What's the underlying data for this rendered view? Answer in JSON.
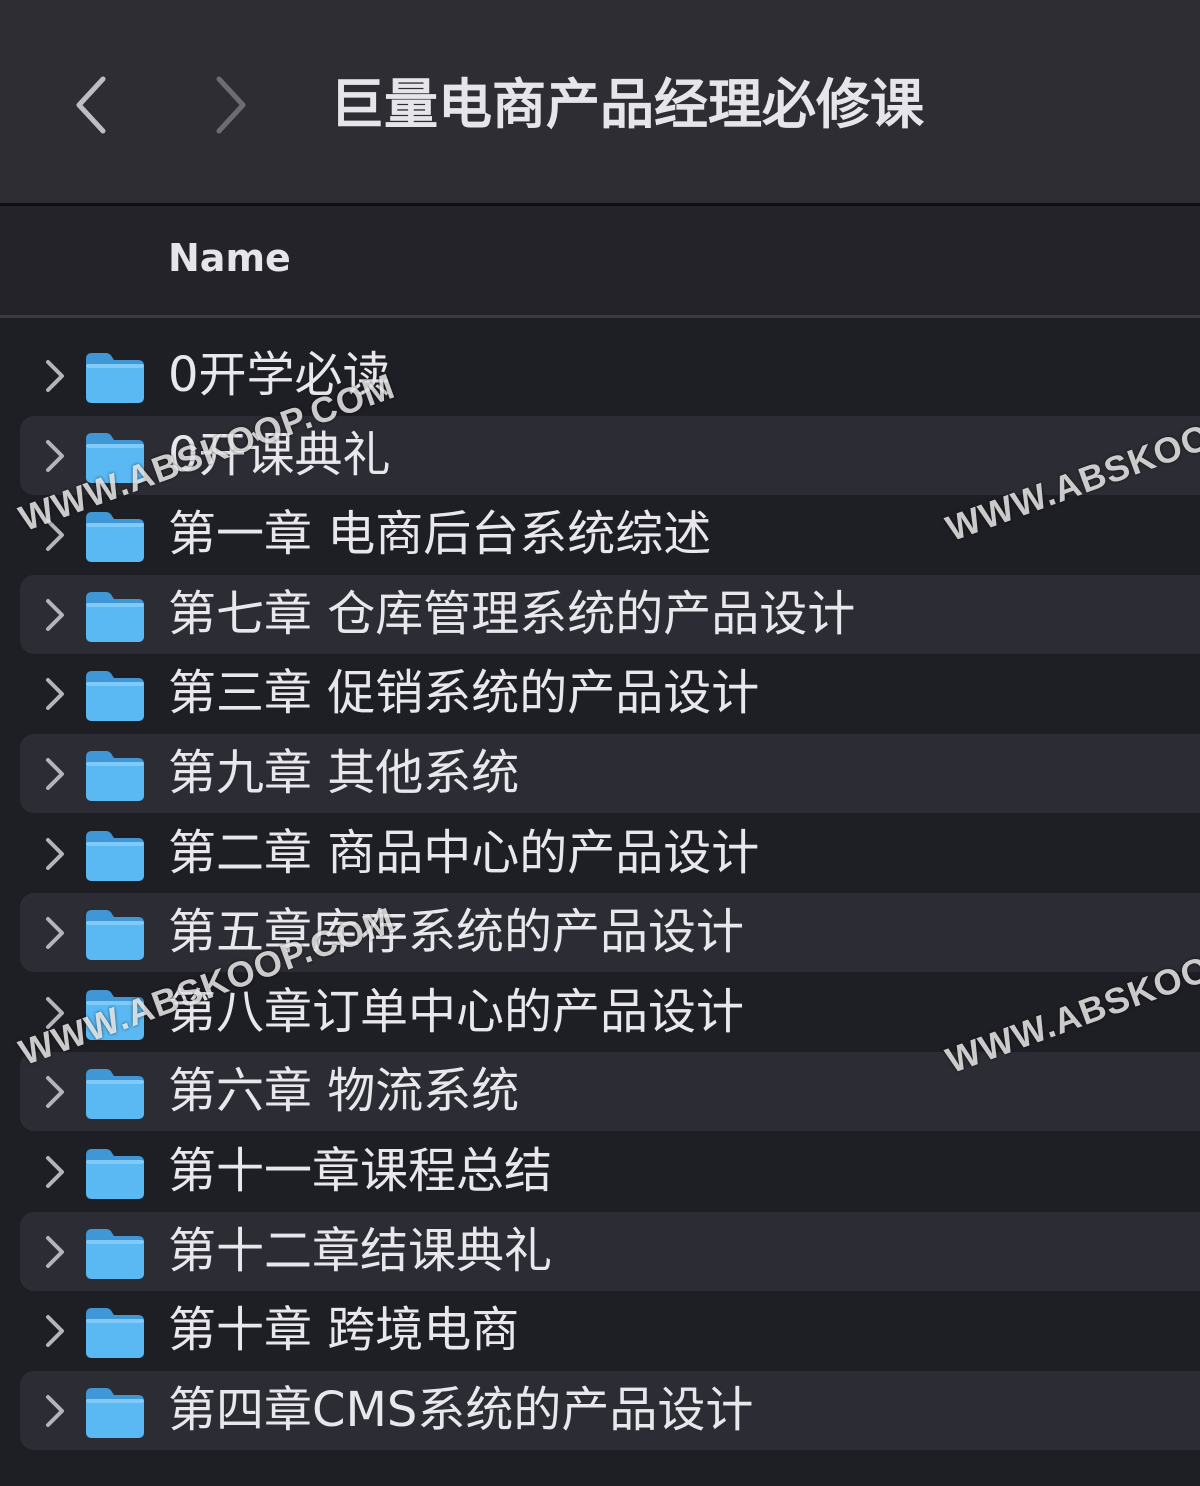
{
  "window": {
    "title": "巨量电商产品经理必修课",
    "back_icon": "chevron-left-icon",
    "forward_icon": "chevron-right-icon"
  },
  "header": {
    "name_column": "Name"
  },
  "rows": [
    {
      "label": "0开学必读"
    },
    {
      "label": "0开课典礼"
    },
    {
      "label": "第一章 电商后台系统综述"
    },
    {
      "label": "第七章 仓库管理系统的产品设计"
    },
    {
      "label": "第三章 促销系统的产品设计"
    },
    {
      "label": "第九章 其他系统"
    },
    {
      "label": "第二章 商品中心的产品设计"
    },
    {
      "label": "第五章库存系统的产品设计"
    },
    {
      "label": "第八章订单中心的产品设计"
    },
    {
      "label": "第六章 物流系统"
    },
    {
      "label": "第十一章课程总结"
    },
    {
      "label": "第十二章结课典礼"
    },
    {
      "label": "第十章 跨境电商"
    },
    {
      "label": "第四章CMS系统的产品设计"
    }
  ],
  "watermark": {
    "left": "WWW.ABSKOOP.COM",
    "right": "WWW.ABSKOOP.COM"
  },
  "colors": {
    "folder": "#5ab8f2",
    "background": "#1e1e25",
    "alt_row": "#2c2c34"
  }
}
